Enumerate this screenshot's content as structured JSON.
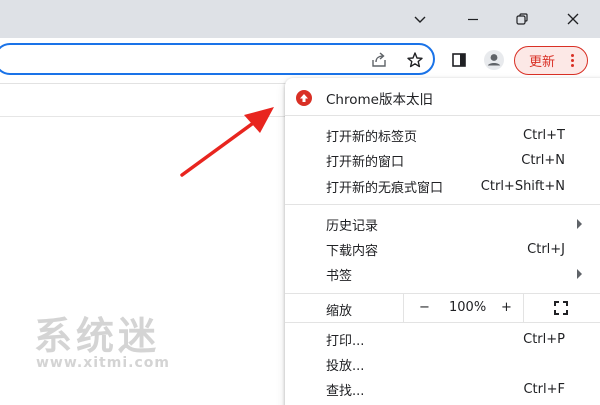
{
  "titlebar": {
    "icons": [
      "chevron-down-icon",
      "minimize-icon",
      "restore-icon",
      "close-icon"
    ]
  },
  "toolbar": {
    "update_label": "更新",
    "icons": [
      "share-icon",
      "star-icon",
      "side-panel-icon",
      "profile-icon",
      "more-vert-icon"
    ]
  },
  "menu": {
    "update_notice": "Chrome版本太旧",
    "items": [
      {
        "label": "打开新的标签页",
        "shortcut": "Ctrl+T"
      },
      {
        "label": "打开新的窗口",
        "shortcut": "Ctrl+N"
      },
      {
        "label": "打开新的无痕式窗口",
        "shortcut": "Ctrl+Shift+N"
      },
      {
        "label": "历史记录",
        "shortcut": ""
      },
      {
        "label": "下载内容",
        "shortcut": "Ctrl+J"
      },
      {
        "label": "书签",
        "shortcut": ""
      },
      {
        "label": "打印...",
        "shortcut": "Ctrl+P"
      },
      {
        "label": "投放...",
        "shortcut": ""
      },
      {
        "label": "查找...",
        "shortcut": "Ctrl+F"
      }
    ],
    "zoom": {
      "label": "缩放",
      "minus": "−",
      "value": "100%",
      "plus": "+"
    }
  },
  "watermark": {
    "big": "系统迷",
    "small": "www.xitmi.com"
  },
  "colors": {
    "accent": "#1a73e8",
    "update_red": "#d93025",
    "titlebar_bg": "#dee1e6"
  }
}
